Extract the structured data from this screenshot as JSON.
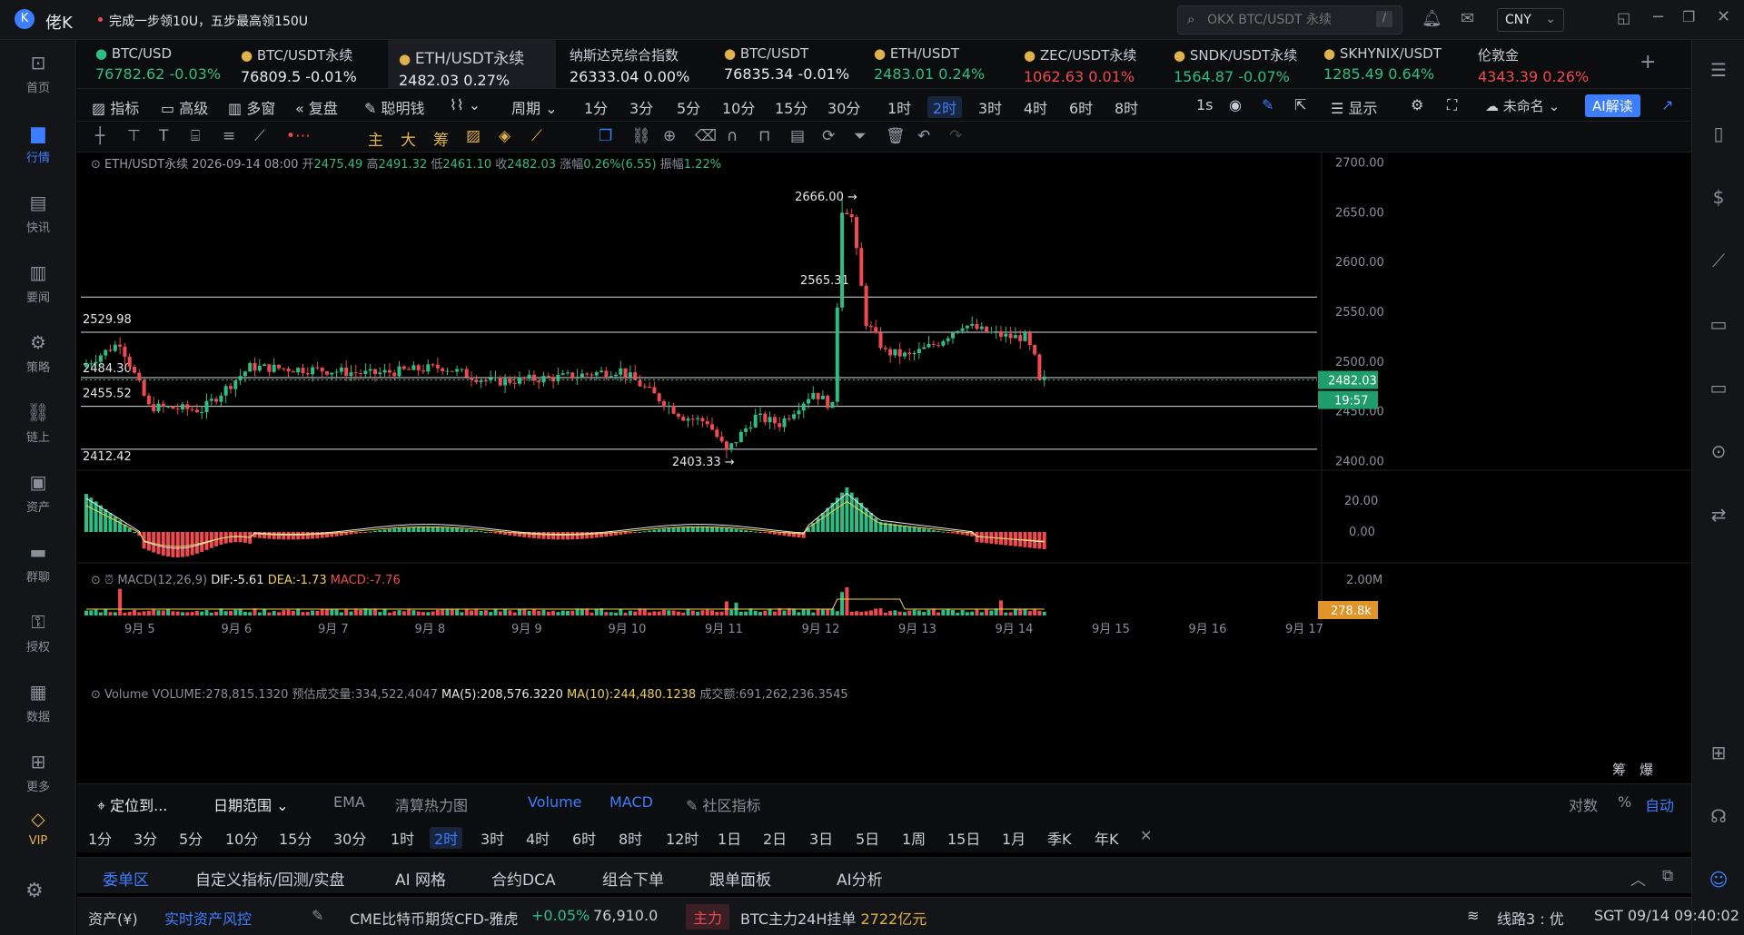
{
  "app": {
    "name": "佬K",
    "promo": "完成一步领10U，五步最高领150U",
    "search_placeholder": "OKX BTC/USDT 永续",
    "search_shortcut": "/",
    "currency": "CNY"
  },
  "nav": [
    {
      "label": "首页",
      "icon": "home-icon"
    },
    {
      "label": "行情",
      "icon": "market-chart-icon"
    },
    {
      "label": "快讯",
      "icon": "flash-news-icon"
    },
    {
      "label": "要闻",
      "icon": "news-icon"
    },
    {
      "label": "策略",
      "icon": "strategy-icon"
    },
    {
      "label": "链上",
      "icon": "onchain-icon"
    },
    {
      "label": "资产",
      "icon": "wallet-icon"
    },
    {
      "label": "群聊",
      "icon": "chat-icon"
    },
    {
      "label": "授权",
      "icon": "key-icon"
    },
    {
      "label": "数据",
      "icon": "data-icon"
    },
    {
      "label": "更多",
      "icon": "more-icon"
    },
    {
      "label": "VIP",
      "icon": "vip-icon"
    }
  ],
  "tickers": [
    {
      "name": "BTC/USD",
      "price": "76782.62",
      "change": "-0.03%",
      "dir": "up"
    },
    {
      "name": "BTC/USDT永续",
      "price": "76809.5",
      "change": "-0.01%",
      "dir": "flat"
    },
    {
      "name": "ETH/USDT永续",
      "price": "2482.03",
      "change": "0.27%",
      "dir": "flat",
      "active": true
    },
    {
      "name": "纳斯达克综合指数",
      "price": "26333.04",
      "change": "0.00%",
      "dir": "flat"
    },
    {
      "name": "BTC/USDT",
      "price": "76835.34",
      "change": "-0.01%",
      "dir": "flat"
    },
    {
      "name": "ETH/USDT",
      "price": "2483.01",
      "change": "0.24%",
      "dir": "up"
    },
    {
      "name": "ZEC/USDT永续",
      "price": "1062.63",
      "change": "0.01%",
      "dir": "down"
    },
    {
      "name": "SNDK/USDT永续",
      "price": "1564.87",
      "change": "-0.07%",
      "dir": "up"
    },
    {
      "name": "SKHYNIX/USDT",
      "price": "1285.49",
      "change": "0.64%",
      "dir": "up"
    },
    {
      "name": "伦敦金",
      "price": "4343.39",
      "change": "0.26%",
      "dir": "down"
    }
  ],
  "toolbar": {
    "items": [
      "指标",
      "高级",
      "多窗",
      "复盘",
      "聪明钱",
      "周期"
    ],
    "periods": [
      "1分",
      "3分",
      "5分",
      "10分",
      "15分",
      "30分",
      "1时",
      "2时",
      "3时",
      "4时",
      "6时",
      "8时"
    ],
    "active_period": "2时",
    "right": [
      "1s",
      "显示",
      "未命名",
      "AI解读"
    ]
  },
  "drawing_tools": [
    "主",
    "大",
    "筹"
  ],
  "chart": {
    "symbol": "ETH/USDT永续",
    "time": "2026-09-14 08:00",
    "open_label": "开",
    "open": "2475.49",
    "high_label": "高",
    "high": "2491.32",
    "low_label": "低",
    "low": "2461.10",
    "close_label": "收",
    "close": "2482.03",
    "chg_label": "涨幅",
    "chg": "0.26%(6.55)",
    "amp_label": "振幅",
    "amp": "1.22%",
    "current_price": "2482.03",
    "countdown": "19:57",
    "macd_title": "MACD(12,26,9)",
    "dif": "DIF:-5.61",
    "dea": "DEA:-1.73",
    "macd": "MACD:-7.76",
    "vol_title": "Volume",
    "vol_value": "VOLUME:278,815.1320",
    "vol_est": "预估成交量:334,522.4047",
    "vol_ma5": "MA(5):208,576.3220",
    "vol_ma10": "MA(10):244,480.1238",
    "vol_turnover": "成交额:691,262,236.3545",
    "vol_current": "278.8k",
    "right_btns": [
      "筹",
      "爆"
    ]
  },
  "chart_data": {
    "type": "candlestick",
    "title": "ETH/USDT永续",
    "x_labels": [
      "9月 5",
      "9月 6",
      "9月 7",
      "9月 8",
      "9月 9",
      "9月 10",
      "9月 11",
      "9月 12",
      "9月 13",
      "9月 14",
      "9月 15",
      "9月 16",
      "9月 17"
    ],
    "y_ticks": [
      "2700.00",
      "2650.00",
      "2600.00",
      "2550.00",
      "2500.00",
      "2450.00",
      "2400.00"
    ],
    "ylim": [
      2395,
      2705
    ],
    "hlines": [
      {
        "value": 2565.31,
        "label": "2565.31"
      },
      {
        "value": 2529.98,
        "label": "2529.98"
      },
      {
        "value": 2484.3,
        "label": "2484.30"
      },
      {
        "value": 2455.52,
        "label": "2455.52"
      },
      {
        "value": 2412.42,
        "label": "2412.42"
      }
    ],
    "annotations": [
      {
        "label": "2666.00",
        "value": 2666.0
      },
      {
        "label": "2403.33",
        "value": 2403.33
      }
    ],
    "macd_ticks": [
      "20.00",
      "0.00"
    ],
    "volume_ticks": [
      "2.00M"
    ],
    "last_price": 2482.03
  },
  "bottom": {
    "locate": "定位到...",
    "range": "日期范围",
    "tabs": [
      "EMA",
      "清算热力图",
      "Volume",
      "MACD",
      "社区指标"
    ],
    "right": [
      "对数",
      "%",
      "自动"
    ],
    "periods": [
      "1分",
      "3分",
      "5分",
      "10分",
      "15分",
      "30分",
      "1时",
      "2时",
      "3时",
      "4时",
      "6时",
      "8时",
      "12时",
      "1日",
      "2日",
      "3日",
      "5日",
      "1周",
      "15日",
      "1月",
      "季K",
      "年K"
    ],
    "active_period": "2时"
  },
  "panel": {
    "tabs": [
      "委单区",
      "自定义指标/回测/实盘",
      "AI 网格",
      "合约DCA",
      "组合下单",
      "跟单面板",
      "AI分析"
    ],
    "active": "委单区"
  },
  "status": {
    "asset": "资产(¥)",
    "risk": "实时资产风控",
    "feed": "CME比特币期货CFD-雅虎",
    "feed_change": "+0.05%",
    "feed_price": "76,910.0",
    "tag": "主力",
    "msg_prefix": "BTC主力24H挂单",
    "msg_value": "2722亿元",
    "line": "线路3 : 优",
    "clock": "SGT 09/14 09:40:02"
  }
}
